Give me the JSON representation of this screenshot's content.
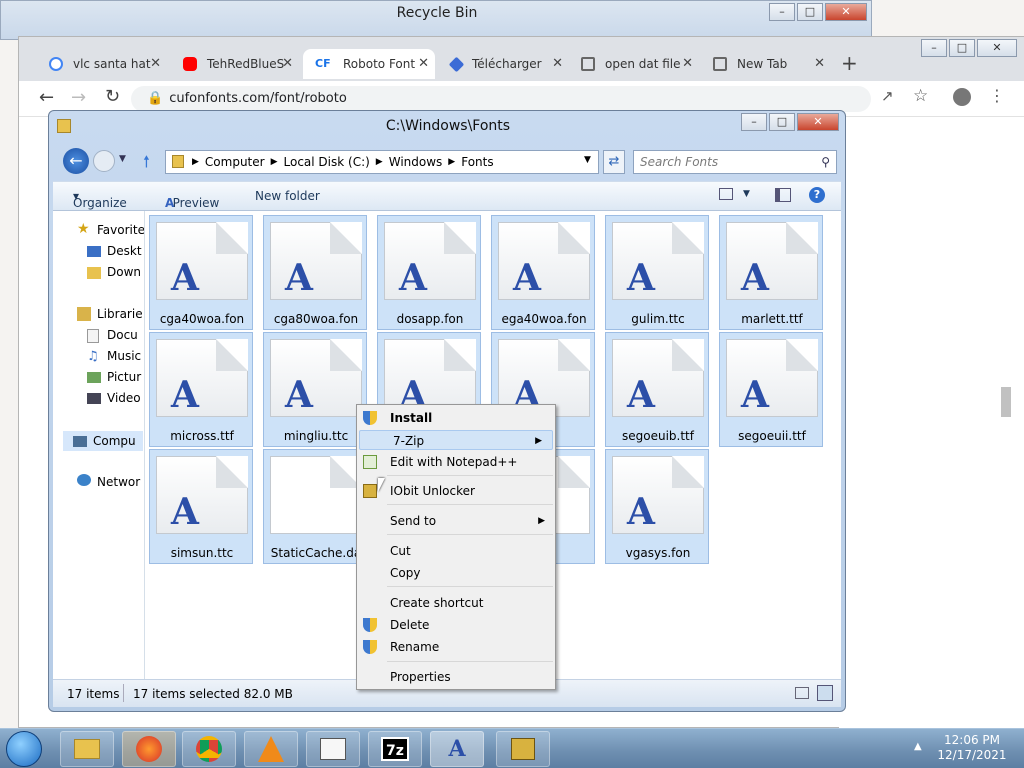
{
  "recycle_bin": {
    "title": "Recycle Bin"
  },
  "chrome": {
    "tabs": [
      {
        "label": "vlc santa hat",
        "favicon": "google-icon",
        "color": "#4285f4"
      },
      {
        "label": "TehRedBlueS",
        "favicon": "youtube-icon",
        "color": "#ff0000"
      },
      {
        "label": "Roboto Font",
        "favicon": "cufonfonts-icon",
        "color": "#1a73e8"
      },
      {
        "label": "Télécharger",
        "favicon": "download-icon",
        "color": "#3b6bd6"
      },
      {
        "label": "open dat file",
        "favicon": "bookmark-icon",
        "color": "#666666"
      },
      {
        "label": "New Tab",
        "favicon": "bookmark-icon",
        "color": "#666666"
      }
    ],
    "url": "cufonfonts.com/font/roboto"
  },
  "explorer": {
    "title": "C:\\Windows\\Fonts",
    "breadcrumb": [
      "Computer",
      "Local Disk (C:)",
      "Windows",
      "Fonts"
    ],
    "search_placeholder": "Search Fonts",
    "toolbar": {
      "organize": "Organize",
      "preview": "Preview",
      "new_folder": "New folder"
    },
    "nav": {
      "favorites": "Favorite",
      "desktop": "Deskt",
      "downloads": "Down",
      "libraries": "Librarie",
      "documents": "Docu",
      "music": "Music",
      "pictures": "Pictur",
      "videos": "Video",
      "computer": "Compu",
      "network": "Networ"
    },
    "files": [
      {
        "name": "cga40woa.fon",
        "glyph": "A"
      },
      {
        "name": "cga80woa.fon",
        "glyph": "A"
      },
      {
        "name": "dosapp.fon",
        "glyph": "A"
      },
      {
        "name": "ega40woa.fon",
        "glyph": "A"
      },
      {
        "name": "gulim.ttc",
        "glyph": "A"
      },
      {
        "name": "marlett.ttf",
        "glyph": "A"
      },
      {
        "name": "micross.ttf",
        "glyph": "A"
      },
      {
        "name": "mingliu.ttc",
        "glyph": "A"
      },
      {
        "name": "",
        "glyph": "A"
      },
      {
        "name": "i.ttf",
        "glyph": "A"
      },
      {
        "name": "segoeuib.ttf",
        "glyph": "A"
      },
      {
        "name": "segoeuii.ttf",
        "glyph": "A"
      },
      {
        "name": "simsun.ttc",
        "glyph": "A"
      },
      {
        "name": "StaticCache.da",
        "glyph": ""
      },
      {
        "name": "",
        "glyph": ""
      },
      {
        "name": ".fon",
        "glyph": ""
      },
      {
        "name": "vgasys.fon",
        "glyph": "A"
      }
    ],
    "status": {
      "count": "17 items",
      "selected": "17 items selected  82.0 MB"
    }
  },
  "context_menu": {
    "items": [
      {
        "label": "Install",
        "bold": true,
        "icon": "shield-icon"
      },
      {
        "label": "7-Zip",
        "submenu": true
      },
      {
        "label": "Edit with Notepad++",
        "icon": "notepad-icon"
      },
      {
        "label": "IObit Unlocker",
        "icon": "lock-icon"
      },
      {
        "label": "Send to",
        "submenu": true
      },
      {
        "label": "Cut"
      },
      {
        "label": "Copy"
      },
      {
        "label": "Create shortcut"
      },
      {
        "label": "Delete",
        "icon": "shield-icon"
      },
      {
        "label": "Rename",
        "icon": "shield-icon"
      },
      {
        "label": "Properties"
      }
    ]
  },
  "taskbar": {
    "items": [
      "start-orb-icon",
      "explorer-icon",
      "firefox-icon",
      "chrome-icon",
      "vlc-icon",
      "taskmgr-icon",
      "7zip-icon",
      "font-viewer-icon",
      "unlocker-icon"
    ],
    "time": "12:06 PM",
    "date": "12/17/2021"
  }
}
